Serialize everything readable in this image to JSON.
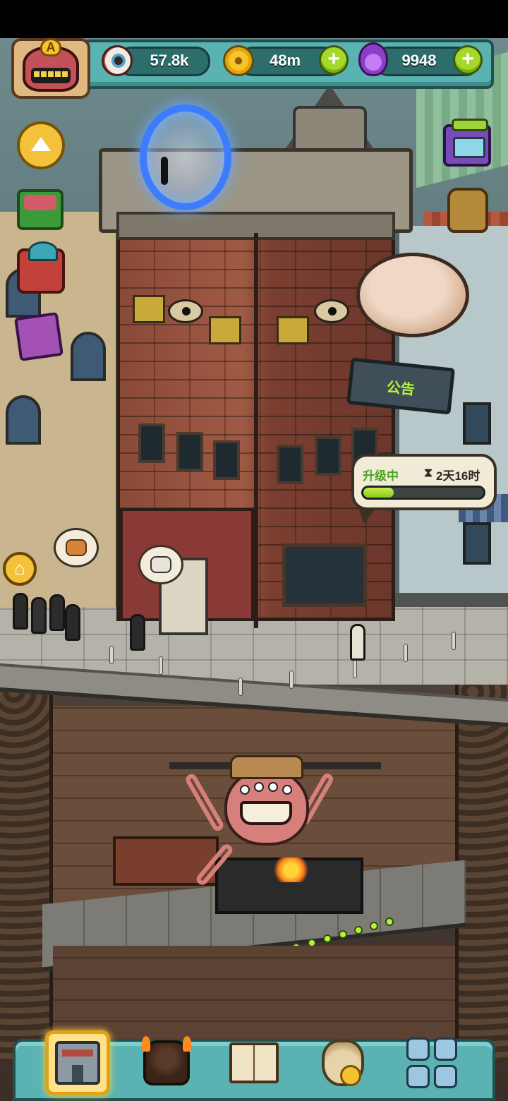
{
  "resources": {
    "eyeballs": {
      "icon": "eyeball-icon",
      "value": "57.8k"
    },
    "coins": {
      "icon": "coin-icon",
      "value": "48m"
    },
    "potions": {
      "icon": "potion-icon",
      "value": "9948"
    }
  },
  "avatar": {
    "rank_badge": "A"
  },
  "announcement": {
    "label": "公告"
  },
  "upgrade": {
    "status": "升级中",
    "time_icon": "hourglass-icon",
    "time_left": "2天16时",
    "progress": 0.25
  },
  "bottom_nav": {
    "items": [
      {
        "icon": "building-icon",
        "active": true
      },
      {
        "icon": "monster-icon",
        "active": false
      },
      {
        "icon": "book-icon",
        "active": false
      },
      {
        "icon": "money-sack-icon",
        "active": false
      },
      {
        "icon": "grid-menu-icon",
        "active": false
      }
    ]
  },
  "colors": {
    "panel_teal": "#5ab3b2",
    "accent_green": "#a6d82a",
    "progress_green": "#88c81c",
    "active_tab": "#ffe28a"
  }
}
